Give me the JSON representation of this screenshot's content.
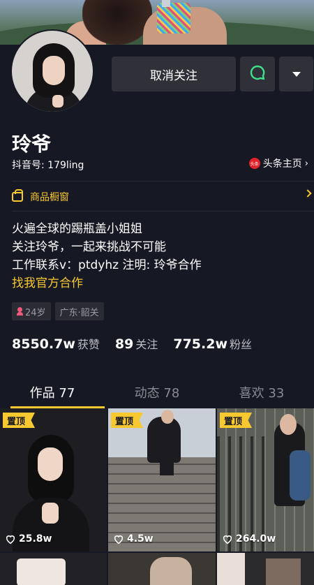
{
  "profile": {
    "name": "玲爷",
    "handle": "抖音号: 179ling",
    "toutiao_label": "头条主页",
    "toutiao_logo": "头条",
    "showcase_label": "商品橱窗",
    "bio_lines": [
      "火遍全球的踢瓶盖小姐姐",
      "关注玲爷，一起来挑战不可能",
      "工作联系v：ptdyhz 注明: 玲爷合作"
    ],
    "bio_link": "找我官方合作",
    "tags": [
      "24岁",
      "广东·韶关"
    ]
  },
  "actions": {
    "unfollow_label": "取消关注",
    "chat_icon": "chat-bubble-icon",
    "more_icon": "triangle-down-icon"
  },
  "stats": [
    {
      "value": "8550.7w",
      "label": "获赞"
    },
    {
      "value": "89",
      "label": "关注"
    },
    {
      "value": "775.2w",
      "label": "粉丝"
    }
  ],
  "tabs": [
    {
      "label": "作品 77",
      "active": true
    },
    {
      "label": "动态 78",
      "active": false
    },
    {
      "label": "喜欢 33",
      "active": false
    }
  ],
  "videos": [
    {
      "pinned_label": "置顶",
      "likes": "25.8w"
    },
    {
      "pinned_label": "置顶",
      "likes": "4.5w"
    },
    {
      "pinned_label": "置顶",
      "likes": "264.0w"
    }
  ],
  "colors": {
    "background": "#161823",
    "accent": "#f8c830",
    "button": "#2f3038",
    "chat_green": "#3ee08a"
  }
}
